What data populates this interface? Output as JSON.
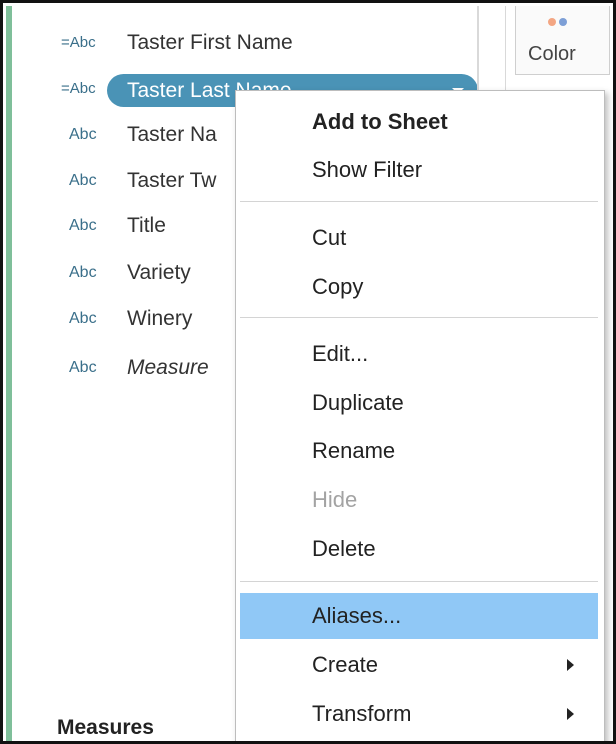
{
  "data_pane": {
    "fields": [
      {
        "type": "=Abc",
        "label": "Taster First Name",
        "italic": false,
        "selected": false
      },
      {
        "type": "=Abc",
        "label": "Taster Last Name",
        "italic": false,
        "selected": true
      },
      {
        "type": "Abc",
        "label": "Taster Na",
        "italic": false,
        "selected": false
      },
      {
        "type": "Abc",
        "label": "Taster Tw",
        "italic": false,
        "selected": false
      },
      {
        "type": "Abc",
        "label": "Title",
        "italic": false,
        "selected": false
      },
      {
        "type": "Abc",
        "label": "Variety",
        "italic": false,
        "selected": false
      },
      {
        "type": "Abc",
        "label": "Winery",
        "italic": false,
        "selected": false
      },
      {
        "type": "Abc",
        "label": "Measure",
        "italic": true,
        "selected": false
      }
    ],
    "measures_header": "Measures"
  },
  "marks_card": {
    "color_label": "Color",
    "icon": "color-dots-icon"
  },
  "context_menu": {
    "add_to_sheet": "Add to Sheet",
    "show_filter": "Show Filter",
    "cut": "Cut",
    "copy": "Copy",
    "edit": "Edit...",
    "duplicate": "Duplicate",
    "rename": "Rename",
    "hide": "Hide",
    "delete": "Delete",
    "aliases": "Aliases...",
    "create": "Create",
    "transform": "Transform",
    "highlighted_item": "Aliases...",
    "disabled_items": [
      "Hide"
    ]
  },
  "colors": {
    "pill_selected": "#4a93b6",
    "menu_highlight": "#90c8f6",
    "pane_edge": "#7fbf9a",
    "field_type_icon": "#3a6f8a"
  }
}
